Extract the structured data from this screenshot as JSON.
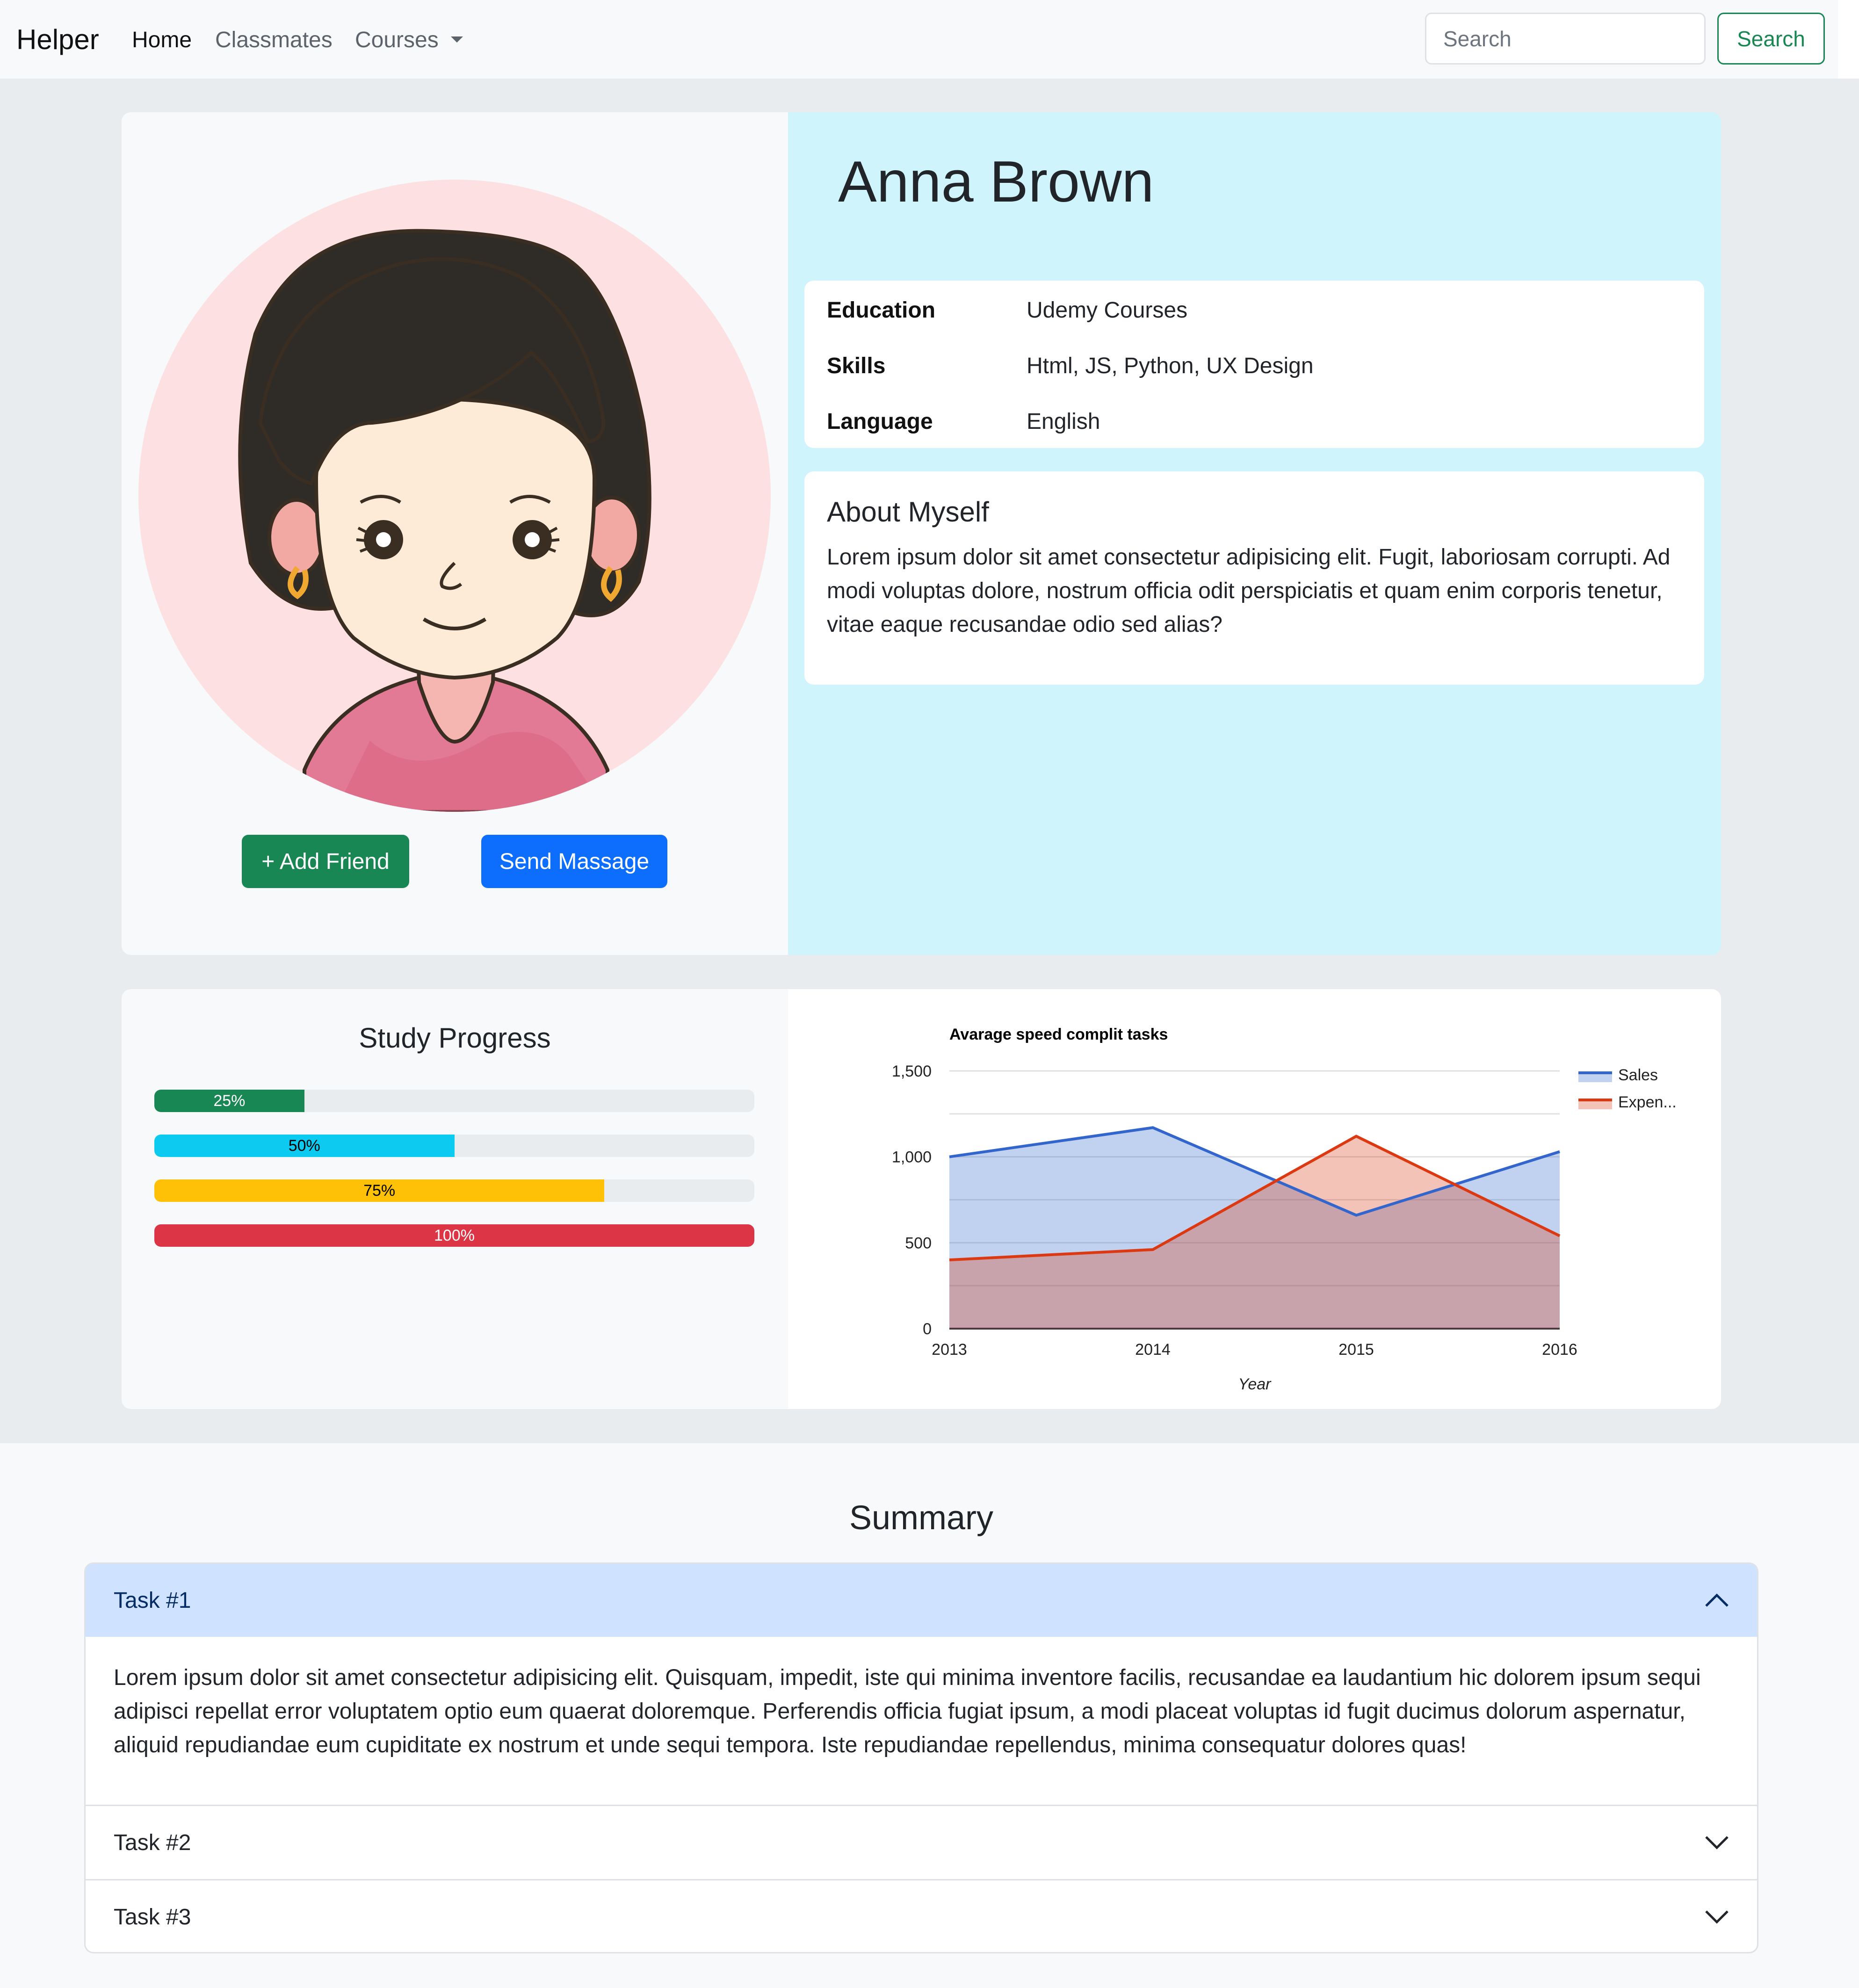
{
  "navbar": {
    "brand": "Helper",
    "links": [
      "Home",
      "Classmates",
      "Courses"
    ],
    "search_placeholder": "Search",
    "search_button": "Search"
  },
  "profile": {
    "name": "Anna Brown",
    "details": [
      {
        "label": "Education",
        "value": "Udemy Courses"
      },
      {
        "label": "Skills",
        "value": "Html, JS, Python, UX Design"
      },
      {
        "label": "Language",
        "value": "English"
      }
    ],
    "about_title": "About Myself",
    "about_text": "Lorem ipsum dolor sit amet consectetur adipisicing elit. Fugit, laboriosam corrupti. Ad modi voluptas dolore, nostrum officia odit perspiciatis et quam enim corporis tenetur, vitae eaque recusandae odio sed alias?",
    "add_friend_button": "+ Add Friend",
    "send_message_button": "Send Massage"
  },
  "study_progress": {
    "title": "Study Progress",
    "bars": [
      {
        "label": "25%",
        "value": 0.25,
        "color": "#198754",
        "text_color": "#ffffff"
      },
      {
        "label": "50%",
        "value": 0.5,
        "color": "#0dcaf0",
        "text_color": "#000000"
      },
      {
        "label": "75%",
        "value": 0.75,
        "color": "#ffc107",
        "text_color": "#000000"
      },
      {
        "label": "100%",
        "value": 1.0,
        "color": "#dc3545",
        "text_color": "#ffffff"
      }
    ]
  },
  "chart_data": {
    "type": "area",
    "title": "Avarage speed complit tasks",
    "xlabel": "Year",
    "ylabel": "",
    "x": [
      "2013",
      "2014",
      "2015",
      "2016"
    ],
    "ylim": [
      0,
      1500
    ],
    "yticks": [
      "0",
      "500",
      "1,000",
      "1,500"
    ],
    "series": [
      {
        "name": "Sales",
        "values": [
          1000,
          1170,
          660,
          1030
        ],
        "color": "#3366cc"
      },
      {
        "name": "Expen...",
        "values": [
          400,
          460,
          1120,
          540
        ],
        "color": "#dc3912"
      }
    ],
    "legend": "right",
    "grid": true
  },
  "summary": {
    "title": "Summary",
    "tasks": [
      {
        "label": "Task #1",
        "expanded": true,
        "body": "Lorem ipsum dolor sit amet consectetur adipisicing elit. Quisquam, impedit, iste qui minima inventore facilis, recusandae ea laudantium hic dolorem ipsum sequi adipisci repellat error voluptatem optio eum quaerat doloremque. Perferendis officia fugiat ipsum, a modi placeat voluptas id fugit ducimus dolorum aspernatur, aliquid repudiandae eum cupiditate ex nostrum et unde sequi tempora. Iste repudiandae repellendus, minima consequatur dolores quas!"
      },
      {
        "label": "Task #2",
        "expanded": false
      },
      {
        "label": "Task #3",
        "expanded": false
      }
    ]
  }
}
